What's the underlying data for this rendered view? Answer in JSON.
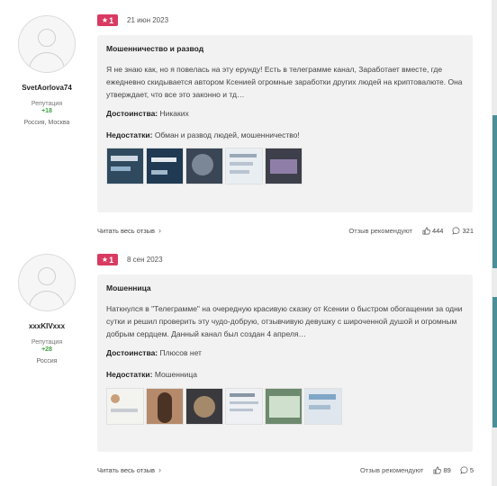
{
  "reviews": [
    {
      "author": {
        "name": "SvetAorlova74",
        "reputation_label": "Репутация",
        "reputation_value": "+18",
        "location": "Россия, Москва"
      },
      "rating": "1",
      "date": "21 июн 2023",
      "title": "Мошенничество и развод",
      "text": "Я не знаю как, но я повелась на эту ерунду! Есть в телеграмме канал, Заработает вместе, где ежедневно скидывается автором Ксенией огромные заработки других людей на криптовалюте. Она утверждает, что все это законно и тд…",
      "pros_label": "Достоинства:",
      "pros": "Никаких",
      "cons_label": "Недостатки:",
      "cons": "Обман и развод людей, мошенничество!",
      "read_more": "Читать весь отзыв",
      "recommends": "Отзыв рекомендуют",
      "likes": "444",
      "comments": "321",
      "thumb_colors": [
        "#2f4a5f",
        "#1f3a52",
        "#3a4656",
        "#e9eef3",
        "#3d3f4a"
      ]
    },
    {
      "author": {
        "name": "xxxKIVxxx",
        "reputation_label": "Репутация",
        "reputation_value": "+28",
        "location": "Россия"
      },
      "rating": "1",
      "date": "8 сен 2023",
      "title": "Мошенница",
      "text": "Наткнулся в \"Телеграмме\" на очередную красивую сказку от Ксении о быстром обогащении за одни сутки и решил проверить эту чудо-добрую, отзывчивую девушку с широченной душой и огромным добрым сердцем. Данный канал был создан 4 апреля…",
      "pros_label": "Достоинства:",
      "pros": "Плюсов нет",
      "cons_label": "Недостатки:",
      "cons": "Мошенница",
      "read_more": "Читать весь отзыв",
      "recommends": "Отзыв рекомендуют",
      "likes": "89",
      "comments": "5",
      "thumb_colors": [
        "#f3f4f0",
        "#b58a6a",
        "#3a3a3e",
        "#eef0f3",
        "#6d8a6e",
        "#dfe6ee"
      ]
    }
  ],
  "colors": {
    "badge": "#d93a62",
    "reputation": "#43a047",
    "card_bg": "#f2f2f2"
  },
  "icons": {
    "star": "star-icon",
    "chevron": "chevron-right-icon",
    "like": "thumbs-up-icon",
    "comment": "comment-icon"
  }
}
